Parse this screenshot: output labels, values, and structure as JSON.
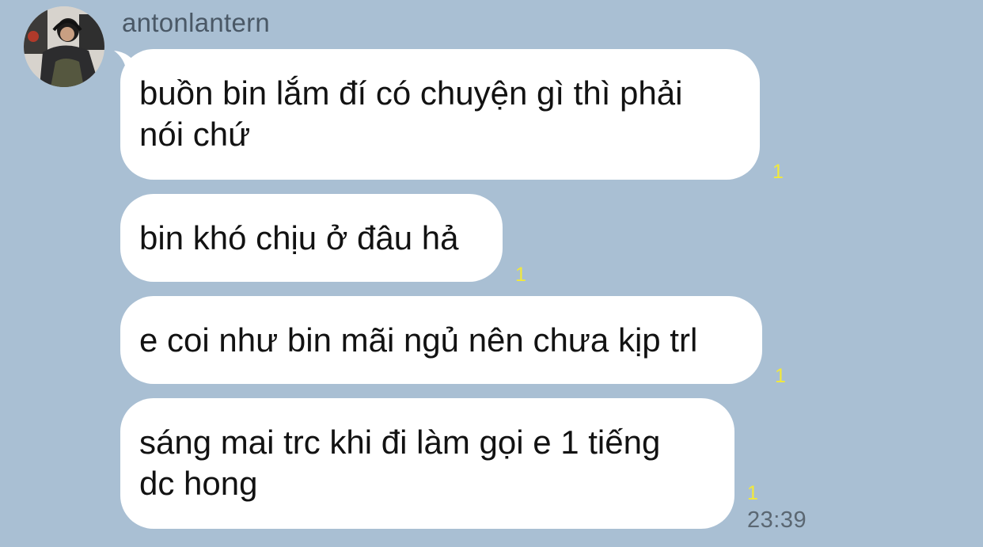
{
  "sender": {
    "name": "antonlantern",
    "avatar": "avatar-photo"
  },
  "messages": [
    {
      "lines": [
        "buồn bin lắm đí có chuyện gì thì phải",
        "nói chứ"
      ],
      "read_count": "1"
    },
    {
      "lines": [
        "bin khó chịu ở đâu hả"
      ],
      "read_count": "1"
    },
    {
      "lines": [
        "e coi như bin mãi ngủ nên chưa kịp trl"
      ],
      "read_count": "1"
    },
    {
      "lines": [
        "sáng mai trc khi đi làm gọi e 1 tiếng",
        "dc hong"
      ],
      "read_count": "1",
      "time": "23:39"
    }
  ],
  "colors": {
    "background": "#a9bfd3",
    "bubble": "#ffffff",
    "read_count": "#f2e93a",
    "timestamp": "#5b6772"
  }
}
